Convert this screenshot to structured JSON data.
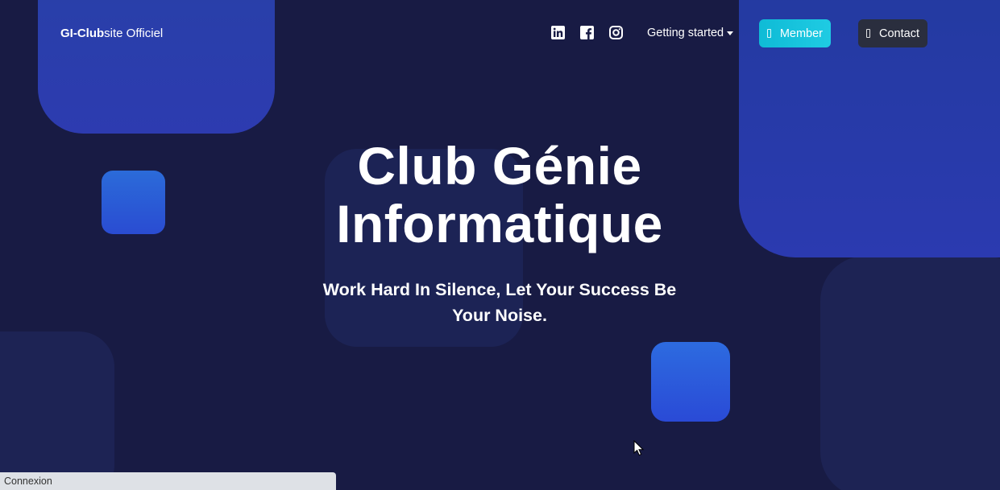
{
  "navbar": {
    "brand_bold": "GI-Club",
    "brand_rest": "site Officiel",
    "social": [
      "linkedin-icon",
      "facebook-icon",
      "instagram-icon"
    ],
    "dropdown_label": "Getting started",
    "member_label": "Member",
    "contact_label": "Contact"
  },
  "hero": {
    "title_line1": "Club Génie",
    "title_line2": "Informatique",
    "subtitle_line1": "Work Hard In Silence, Let Your Success Be",
    "subtitle_line2": "Your Noise."
  },
  "status_bar": {
    "text": "Connexion"
  },
  "colors": {
    "background": "#181b44",
    "accent_member": "#1fcbe3",
    "shape_blue": "#2a4cd2",
    "contact_button": "#2a2e3e"
  }
}
